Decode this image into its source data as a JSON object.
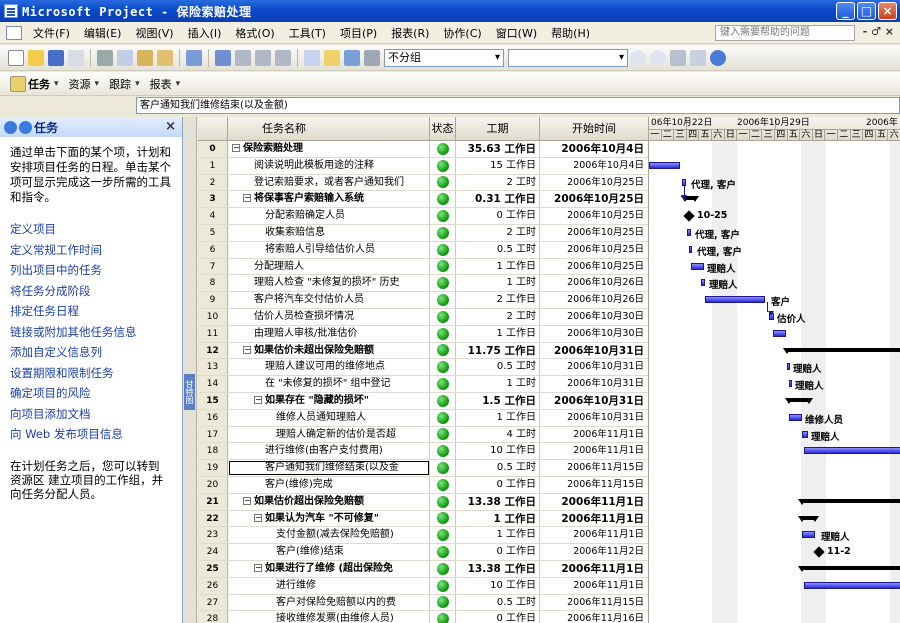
{
  "window": {
    "title": "Microsoft Project - 保险索赔处理"
  },
  "menu": {
    "items": [
      "文件(F)",
      "编辑(E)",
      "视图(V)",
      "插入(I)",
      "格式(O)",
      "工具(T)",
      "项目(P)",
      "报表(R)",
      "协作(C)",
      "窗口(W)",
      "帮助(H)"
    ],
    "help_placeholder": "键入需要帮助的问题",
    "right_symbol": "- ♂ ×"
  },
  "toolbar": {
    "group_select": "不分组"
  },
  "views_bar": {
    "tasks": "任务",
    "resources": "资源",
    "track": "跟踪",
    "report": "报表"
  },
  "entry": {
    "value": "客户通知我们维修结束(以及金额)"
  },
  "task_pane": {
    "title": "任务",
    "intro": "通过单击下面的某个项，计划和安排项目任务的日程。单击某个项可显示完成这一步所需的工具和指令。",
    "links": [
      "定义项目",
      "定义常规工作时间",
      "列出项目中的任务",
      "将任务分成阶段",
      "排定任务日程",
      "链接或附加其他任务信息",
      "添加自定义信息列",
      "设置期限和限制任务",
      "确定项目的风险",
      "向项目添加文档",
      "向 Web 发布项目信息"
    ],
    "footer": "在计划任务之后，您可以转到 资源区 建立项目的工作组，并向任务分配人员。"
  },
  "grid": {
    "headers": {
      "id": "",
      "name": "任务名称",
      "status": "状态",
      "duration": "工期",
      "start": "开始时间"
    },
    "rows": [
      {
        "id": "0",
        "name": "保险索赔处理",
        "duration": "35.63 工作日",
        "start": "2006年10月4日",
        "summary": true,
        "level": 0
      },
      {
        "id": "1",
        "name": "阅读说明此模板用途的注释",
        "duration": "15 工作日",
        "start": "2006年10月4日",
        "level": 2
      },
      {
        "id": "2",
        "name": "登记索赔要求，或者客户通知我们",
        "duration": "2 工时",
        "start": "2006年10月25日",
        "level": 2
      },
      {
        "id": "3",
        "name": "将保事客户索赔输入系统",
        "duration": "0.31 工作日",
        "start": "2006年10月25日",
        "summary": true,
        "level": 1
      },
      {
        "id": "4",
        "name": "分配索赔确定人员",
        "duration": "0 工作日",
        "start": "2006年10月25日",
        "level": 3
      },
      {
        "id": "5",
        "name": "收集索赔信息",
        "duration": "2 工时",
        "start": "2006年10月25日",
        "level": 3
      },
      {
        "id": "6",
        "name": "将索赔人引导给估价人员",
        "duration": "0.5 工时",
        "start": "2006年10月25日",
        "level": 3
      },
      {
        "id": "7",
        "name": "分配理赔人",
        "duration": "1 工作日",
        "start": "2006年10月25日",
        "level": 2
      },
      {
        "id": "8",
        "name": "理赔人检查 \"未修复的损坏\" 历史",
        "duration": "1 工时",
        "start": "2006年10月26日",
        "level": 2
      },
      {
        "id": "9",
        "name": "客户将汽车交付估价人员",
        "duration": "2 工作日",
        "start": "2006年10月26日",
        "level": 2
      },
      {
        "id": "10",
        "name": "估价人员检查损坏情况",
        "duration": "2 工时",
        "start": "2006年10月30日",
        "level": 2
      },
      {
        "id": "11",
        "name": "由理赔人审核/批准估价",
        "duration": "1 工作日",
        "start": "2006年10月30日",
        "level": 2
      },
      {
        "id": "12",
        "name": "如果估价未超出保险免赔额",
        "duration": "11.75 工作日",
        "start": "2006年10月31日",
        "summary": true,
        "level": 1
      },
      {
        "id": "13",
        "name": "理赔人建议可用的维修地点",
        "duration": "0.5 工时",
        "start": "2006年10月31日",
        "level": 3
      },
      {
        "id": "14",
        "name": "在 \"未修复的损坏\" 组中登记",
        "duration": "1 工时",
        "start": "2006年10月31日",
        "level": 3
      },
      {
        "id": "15",
        "name": "如果存在 \"隐藏的损坏\"",
        "duration": "1.5 工作日",
        "start": "2006年10月31日",
        "summary": true,
        "level": 2
      },
      {
        "id": "16",
        "name": "维修人员通知理赔人",
        "duration": "1 工作日",
        "start": "2006年10月31日",
        "level": 4
      },
      {
        "id": "17",
        "name": "理赔人确定新的估价是否超",
        "duration": "4 工时",
        "start": "2006年11月1日",
        "level": 4
      },
      {
        "id": "18",
        "name": "进行维修(由客户支付费用)",
        "duration": "10 工作日",
        "start": "2006年11月1日",
        "level": 3
      },
      {
        "id": "19",
        "name": "客户通知我们维修结束(以及金",
        "duration": "0.5 工时",
        "start": "2006年11月15日",
        "level": 3,
        "selected": true
      },
      {
        "id": "20",
        "name": "客户(维修)完成",
        "duration": "0 工作日",
        "start": "2006年11月15日",
        "level": 3
      },
      {
        "id": "21",
        "name": "如果估价超出保险免赔额",
        "duration": "13.38 工作日",
        "start": "2006年11月1日",
        "summary": true,
        "level": 1
      },
      {
        "id": "22",
        "name": "如果认为汽车 \"不可修复\"",
        "duration": "1 工作日",
        "start": "2006年11月1日",
        "summary": true,
        "level": 2
      },
      {
        "id": "23",
        "name": "支付金额(减去保险免赔额)",
        "duration": "1 工作日",
        "start": "2006年11月1日",
        "level": 4
      },
      {
        "id": "24",
        "name": "客户(维修)结束",
        "duration": "0 工作日",
        "start": "2006年11月2日",
        "level": 4
      },
      {
        "id": "25",
        "name": "如果进行了维修 (超出保险免",
        "duration": "13.38 工作日",
        "start": "2006年11月1日",
        "summary": true,
        "level": 2
      },
      {
        "id": "26",
        "name": "进行维修",
        "duration": "10 工作日",
        "start": "2006年11月1日",
        "level": 4
      },
      {
        "id": "27",
        "name": "客户对保险免赔额以内的费",
        "duration": "0.5 工时",
        "start": "2006年11月15日",
        "level": 4
      },
      {
        "id": "28",
        "name": "接收维修发票(由维修人员)",
        "duration": "0 工作日",
        "start": "2006年11月16日",
        "level": 4
      },
      {
        "id": "29",
        "name": "理赔人批准向维修人员的付",
        "duration": "1 工作日",
        "start": "2006年11月20日",
        "level": 4
      }
    ]
  },
  "gantt": {
    "weeks": [
      "06年10月22日",
      "2006年10月29日",
      "2006年"
    ],
    "days": [
      "一",
      "二",
      "三",
      "四",
      "五",
      "六",
      "日",
      "一",
      "二",
      "三",
      "四",
      "五",
      "六",
      "日",
      "一",
      "二",
      "三",
      "四",
      "五",
      "六"
    ],
    "labels": [
      "代理, 客户",
      "10-25",
      "代理, 客户",
      "代理, 客户",
      "理赔人",
      "理赔人",
      "客户",
      "估价人",
      "理赔人",
      "理赔人",
      "维修人员",
      "理赔人",
      "理赔人",
      "11-2"
    ]
  }
}
